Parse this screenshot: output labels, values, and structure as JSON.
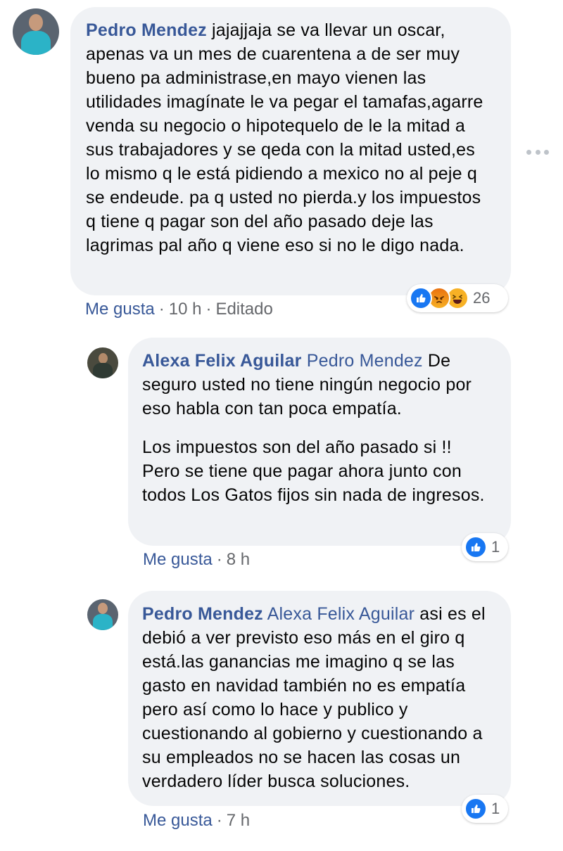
{
  "comments": [
    {
      "author": "Pedro Mendez",
      "text": "jajajjaja se va llevar un oscar, apenas va un mes de cuarentena a de ser muy bueno pa administrase,en mayo vienen las utilidades imagínate le va pegar el tamafas,agarre venda su negocio o hipotequelo de le la mitad a sus trabajadores y se qeda con la mitad usted,es lo mismo q le está pidiendo a mexico no al peje q se endeude. pa q usted no pierda.y los impuestos q tiene q pagar son del año pasado deje las lagrimas pal año q viene eso si no le digo nada.",
      "like_label": "Me gusta",
      "time": "10 h",
      "edited": "Editado",
      "reactions": [
        "like",
        "angry",
        "haha"
      ],
      "reaction_count": "26"
    },
    {
      "author": "Alexa Felix Aguilar",
      "mention": "Pedro Mendez",
      "text": "De seguro usted no tiene ningún negocio por eso habla con tan poca empatía.",
      "text2": "Los impuestos son del año pasado si !! Pero se tiene que pagar ahora junto con todos Los Gatos fijos sin nada de ingresos.",
      "like_label": "Me gusta",
      "time": "8 h",
      "reactions": [
        "like"
      ],
      "reaction_count": "1"
    },
    {
      "author": "Pedro Mendez",
      "mention": "Alexa Felix Aguilar",
      "text": "asi es el debió a ver previsto eso más en el giro q está.las ganancias me imagino q se las gasto en navidad también no es empatía pero así como lo hace y publico y cuestionando al gobierno y cuestionando a su empleados no se hacen las cosas un verdadero líder busca soluciones.",
      "like_label": "Me gusta",
      "time": "7 h",
      "reactions": [
        "like"
      ],
      "reaction_count": "1"
    }
  ],
  "separator": "·",
  "icons": {
    "more": "more-options-icon",
    "like": "like-reaction-icon",
    "angry": "angry-reaction-icon",
    "haha": "haha-reaction-icon"
  },
  "colors": {
    "link": "#385898",
    "bubble": "#f0f2f5",
    "meta": "#65676b",
    "like_blue": "#1877f2",
    "reaction_yellow": "#f7b125"
  }
}
